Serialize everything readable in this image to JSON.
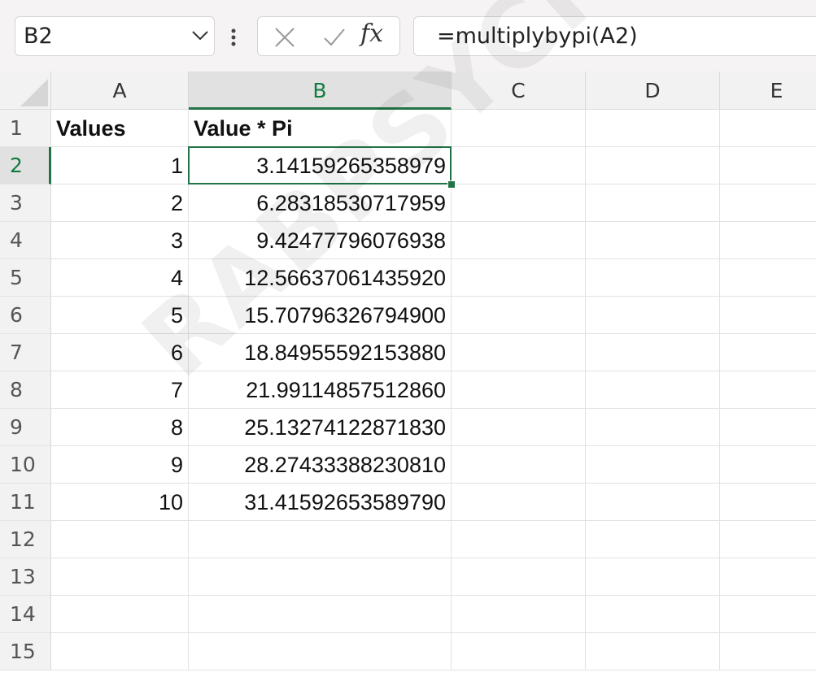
{
  "formula_bar": {
    "name_box": "B2",
    "formula": "=multiplybypi(A2)",
    "fx_label": "fx"
  },
  "columns": [
    {
      "key": "row",
      "label": ""
    },
    {
      "key": "A",
      "label": "A"
    },
    {
      "key": "B",
      "label": "B",
      "active": true
    },
    {
      "key": "C",
      "label": "C"
    },
    {
      "key": "D",
      "label": "D"
    },
    {
      "key": "E",
      "label": "E"
    }
  ],
  "rows": [
    {
      "n": "1",
      "A": "Values",
      "B": "Value * Pi",
      "header": true
    },
    {
      "n": "2",
      "A": "1",
      "B": "3.14159265358979"
    },
    {
      "n": "3",
      "A": "2",
      "B": "6.28318530717959"
    },
    {
      "n": "4",
      "A": "3",
      "B": "9.42477796076938"
    },
    {
      "n": "5",
      "A": "4",
      "B": "12.56637061435920"
    },
    {
      "n": "6",
      "A": "5",
      "B": "15.70796326794900"
    },
    {
      "n": "7",
      "A": "6",
      "B": "18.84955592153880"
    },
    {
      "n": "8",
      "A": "7",
      "B": "21.99114857512860"
    },
    {
      "n": "9",
      "A": "8",
      "B": "25.13274122871830"
    },
    {
      "n": "10",
      "A": "9",
      "B": "28.27433388230810"
    },
    {
      "n": "11",
      "A": "10",
      "B": "31.41592653589790"
    },
    {
      "n": "12",
      "A": "",
      "B": ""
    },
    {
      "n": "13",
      "A": "",
      "B": ""
    },
    {
      "n": "14",
      "A": "",
      "B": ""
    },
    {
      "n": "15",
      "A": "",
      "B": ""
    }
  ],
  "selected_cell": "B2",
  "watermark": "RABPSYCHOLOGY.C",
  "colors": {
    "accent": "#217346",
    "header_bg": "#f2f2f2",
    "active_header_bg": "#e1e1e1"
  }
}
